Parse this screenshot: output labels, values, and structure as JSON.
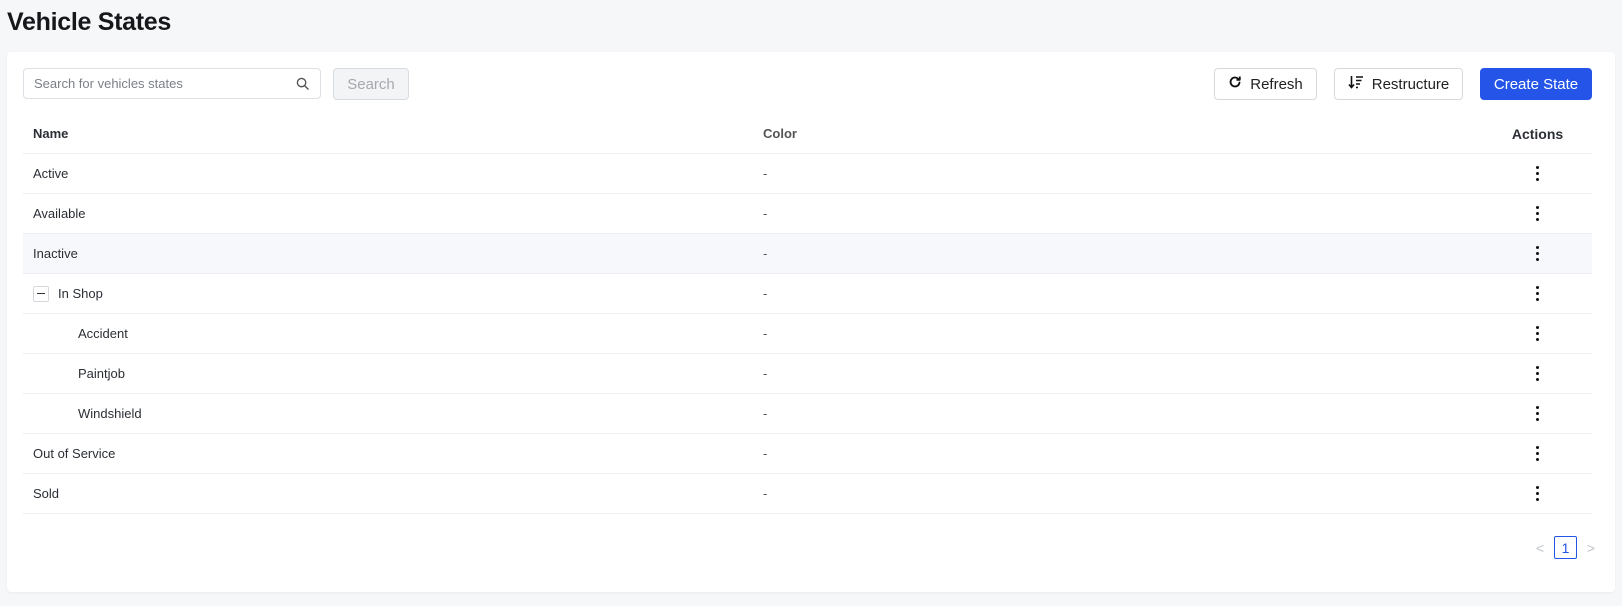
{
  "page": {
    "title": "Vehicle States"
  },
  "toolbar": {
    "search_placeholder": "Search for vehicles states",
    "search_value": "",
    "search_label": "Search",
    "refresh_label": "Refresh",
    "restructure_label": "Restructure",
    "create_label": "Create State"
  },
  "colors": {
    "accent": "#2455e8"
  },
  "table": {
    "columns": {
      "name": "Name",
      "color": "Color",
      "actions": "Actions"
    },
    "rows": [
      {
        "name": "Active",
        "color": "-",
        "level": 0
      },
      {
        "name": "Available",
        "color": "-",
        "level": 0
      },
      {
        "name": "Inactive",
        "color": "-",
        "level": 0
      },
      {
        "name": "In Shop",
        "color": "-",
        "level": 0,
        "expanded": true
      },
      {
        "name": "Accident",
        "color": "-",
        "level": 1
      },
      {
        "name": "Paintjob",
        "color": "-",
        "level": 1
      },
      {
        "name": "Windshield",
        "color": "-",
        "level": 1
      },
      {
        "name": "Out of Service",
        "color": "-",
        "level": 0
      },
      {
        "name": "Sold",
        "color": "-",
        "level": 0
      }
    ]
  },
  "pagination": {
    "current_page": "1",
    "prev": "<",
    "next": ">"
  }
}
